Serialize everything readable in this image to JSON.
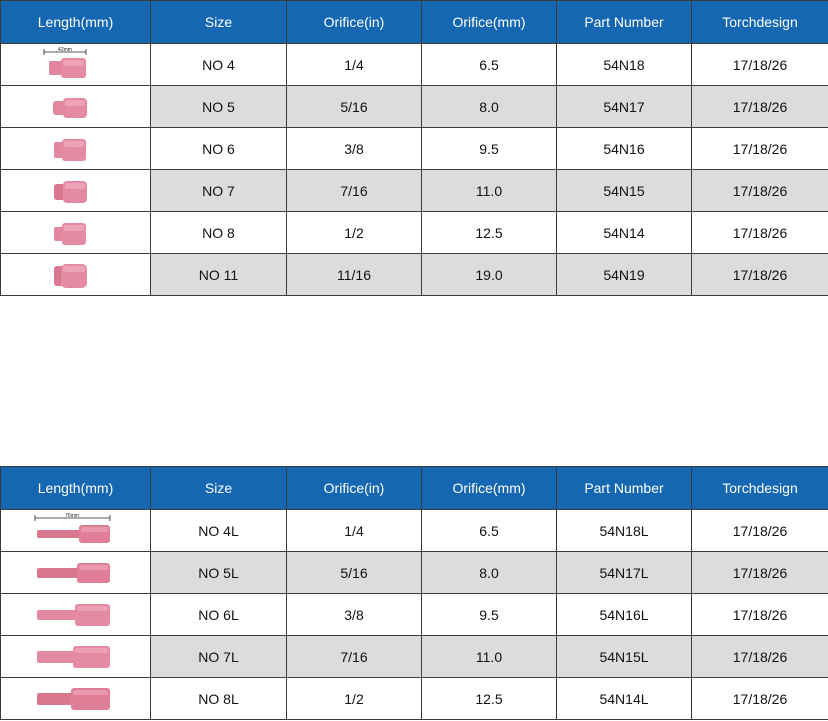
{
  "colors": {
    "header": "#1467b0",
    "shade": "#dcdcdc",
    "ceramic": "#e58aa3"
  },
  "headers": [
    "Length(mm)",
    "Size",
    "Orifice(in)",
    "Orifice(mm)",
    "Part Number",
    "Torchdesign"
  ],
  "top": {
    "dimension_label": "42mm",
    "rows": [
      {
        "size": "NO 4",
        "orifice_in": "1/4",
        "orifice_mm": "6.5",
        "part": "54N18",
        "torch": "17/18/26"
      },
      {
        "size": "NO 5",
        "orifice_in": "5/16",
        "orifice_mm": "8.0",
        "part": "54N17",
        "torch": "17/18/26"
      },
      {
        "size": "NO 6",
        "orifice_in": "3/8",
        "orifice_mm": "9.5",
        "part": "54N16",
        "torch": "17/18/26"
      },
      {
        "size": "NO 7",
        "orifice_in": "7/16",
        "orifice_mm": "11.0",
        "part": "54N15",
        "torch": "17/18/26"
      },
      {
        "size": "NO 8",
        "orifice_in": "1/2",
        "orifice_mm": "12.5",
        "part": "54N14",
        "torch": "17/18/26"
      },
      {
        "size": "NO 11",
        "orifice_in": "11/16",
        "orifice_mm": "19.0",
        "part": "54N19",
        "torch": "17/18/26"
      }
    ]
  },
  "bottom": {
    "dimension_label": "76mm",
    "rows": [
      {
        "size": "NO 4L",
        "orifice_in": "1/4",
        "orifice_mm": "6.5",
        "part": "54N18L",
        "torch": "17/18/26"
      },
      {
        "size": "NO 5L",
        "orifice_in": "5/16",
        "orifice_mm": "8.0",
        "part": "54N17L",
        "torch": "17/18/26"
      },
      {
        "size": "NO 6L",
        "orifice_in": "3/8",
        "orifice_mm": "9.5",
        "part": "54N16L",
        "torch": "17/18/26"
      },
      {
        "size": "NO 7L",
        "orifice_in": "7/16",
        "orifice_mm": "11.0",
        "part": "54N15L",
        "torch": "17/18/26"
      },
      {
        "size": "NO 8L",
        "orifice_in": "1/2",
        "orifice_mm": "12.5",
        "part": "54N14L",
        "torch": "17/18/26"
      }
    ]
  }
}
